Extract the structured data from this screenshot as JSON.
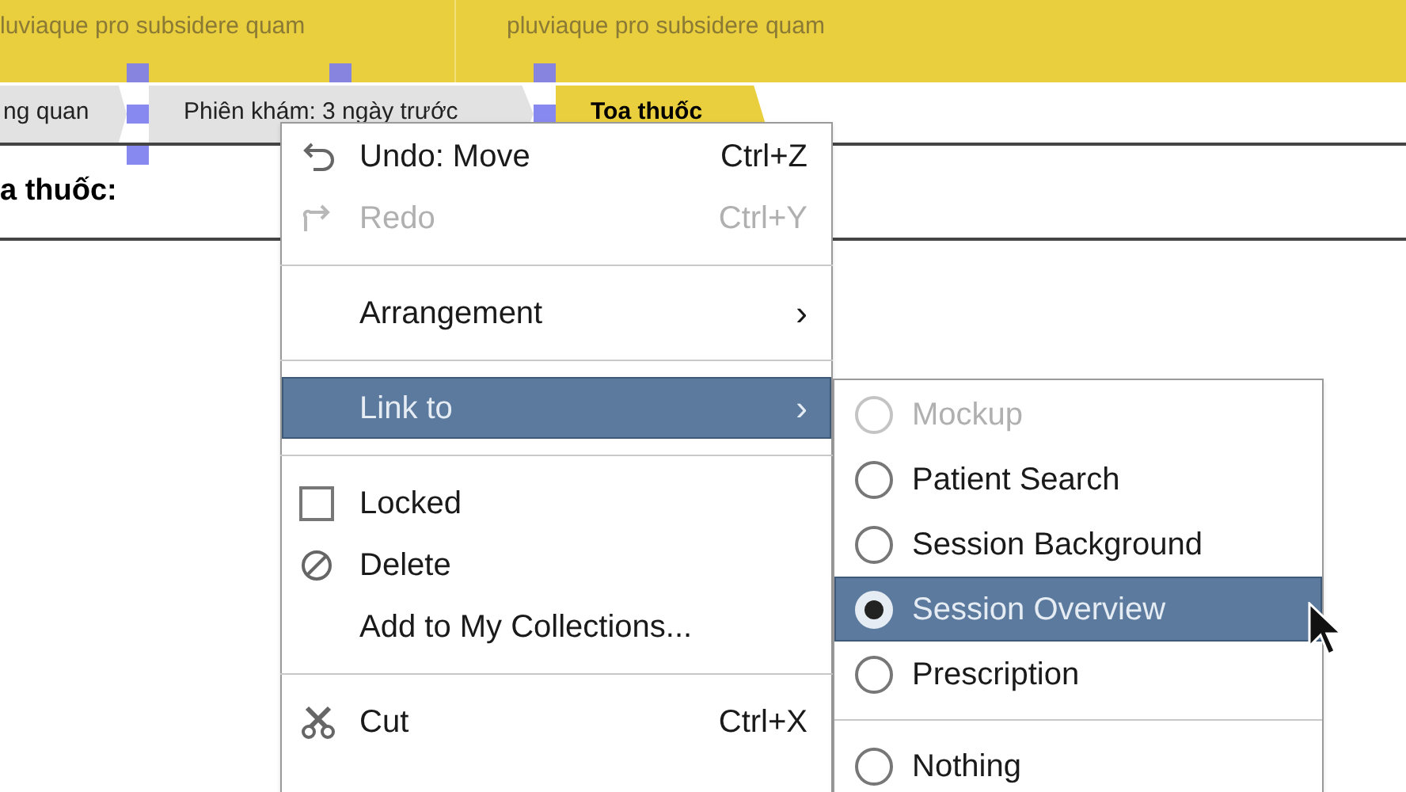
{
  "header": {
    "sections": [
      {
        "subtitle": "luviaque pro subsidere quam"
      },
      {
        "subtitle": "pluviaque pro subsidere quam"
      }
    ]
  },
  "tabs": [
    {
      "label": "ng quan",
      "selected": false
    },
    {
      "label": "Phiên khám: 3 ngày trước",
      "selected": false
    },
    {
      "label": "Toa thuốc",
      "selected": true
    }
  ],
  "field_label": "a thuốc:",
  "context_menu": {
    "items": [
      {
        "kind": "undo",
        "label": "Undo: Move",
        "shortcut": "Ctrl+Z",
        "disabled": false,
        "highlighted": false
      },
      {
        "kind": "redo",
        "label": "Redo",
        "shortcut": "Ctrl+Y",
        "disabled": true,
        "highlighted": false
      },
      {
        "kind": "separator"
      },
      {
        "kind": "submenu",
        "label": "Arrangement",
        "arrow": "›",
        "highlighted": false
      },
      {
        "kind": "separator"
      },
      {
        "kind": "submenu",
        "label": "Link to",
        "arrow": "›",
        "highlighted": true
      },
      {
        "kind": "separator"
      },
      {
        "kind": "checkbox",
        "label": "Locked",
        "checked": false,
        "highlighted": false
      },
      {
        "kind": "delete",
        "label": "Delete",
        "disabled": false,
        "highlighted": false
      },
      {
        "kind": "plain",
        "label": "Add to My Collections...",
        "disabled": false,
        "highlighted": false
      },
      {
        "kind": "separator"
      },
      {
        "kind": "cut",
        "label": "Cut",
        "shortcut": "Ctrl+X",
        "disabled": false,
        "highlighted": false
      }
    ]
  },
  "link_submenu": {
    "items": [
      {
        "kind": "radio",
        "label": "Mockup",
        "selected": false,
        "disabled": true
      },
      {
        "kind": "radio",
        "label": "Patient Search",
        "selected": false,
        "disabled": false
      },
      {
        "kind": "radio",
        "label": "Session Background",
        "selected": false,
        "disabled": false
      },
      {
        "kind": "radio",
        "label": "Session Overview",
        "selected": true,
        "disabled": false
      },
      {
        "kind": "radio",
        "label": "Prescription",
        "selected": false,
        "disabled": false
      },
      {
        "kind": "separator"
      },
      {
        "kind": "radio",
        "label": "Nothing",
        "selected": false,
        "disabled": false
      }
    ]
  }
}
